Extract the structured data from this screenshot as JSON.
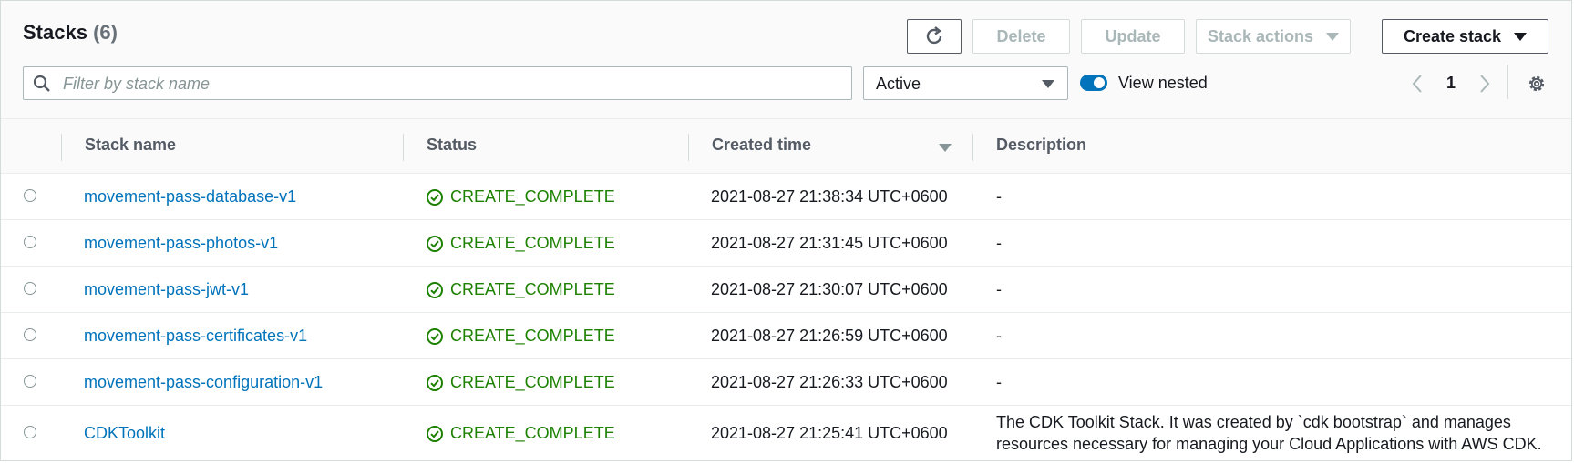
{
  "header": {
    "title": "Stacks",
    "count": "(6)",
    "buttons": {
      "refresh": "refresh-icon",
      "delete": "Delete",
      "update": "Update",
      "stack_actions": "Stack actions",
      "create_stack": "Create stack"
    }
  },
  "filter": {
    "placeholder": "Filter by stack name",
    "status_select": "Active",
    "view_nested_label": "View nested",
    "view_nested_on": true
  },
  "pagination": {
    "page": "1"
  },
  "table": {
    "columns": [
      "Stack name",
      "Status",
      "Created time",
      "Description"
    ],
    "sort_column": "Created time",
    "rows": [
      {
        "name": "movement-pass-database-v1",
        "status": "CREATE_COMPLETE",
        "created": "2021-08-27 21:38:34 UTC+0600",
        "description": "-"
      },
      {
        "name": "movement-pass-photos-v1",
        "status": "CREATE_COMPLETE",
        "created": "2021-08-27 21:31:45 UTC+0600",
        "description": "-"
      },
      {
        "name": "movement-pass-jwt-v1",
        "status": "CREATE_COMPLETE",
        "created": "2021-08-27 21:30:07 UTC+0600",
        "description": "-"
      },
      {
        "name": "movement-pass-certificates-v1",
        "status": "CREATE_COMPLETE",
        "created": "2021-08-27 21:26:59 UTC+0600",
        "description": "-"
      },
      {
        "name": "movement-pass-configuration-v1",
        "status": "CREATE_COMPLETE",
        "created": "2021-08-27 21:26:33 UTC+0600",
        "description": "-"
      },
      {
        "name": "CDKToolkit",
        "status": "CREATE_COMPLETE",
        "created": "2021-08-27 21:25:41 UTC+0600",
        "description_lines": [
          "The CDK Toolkit Stack. It was created by `cdk bootstrap` and manages",
          "resources necessary for managing your Cloud Applications with AWS CDK."
        ]
      }
    ]
  },
  "colors": {
    "link": "#0073bb",
    "success": "#1d8102",
    "toggle": "#0073bb",
    "muted": "#aab7b8"
  }
}
